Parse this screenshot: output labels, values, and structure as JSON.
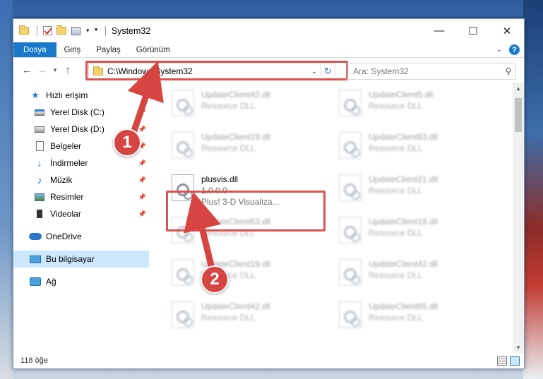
{
  "window": {
    "title": "System32",
    "controls": {
      "minimize": "—",
      "maximize": "☐",
      "close": "✕"
    }
  },
  "ribbon": {
    "tabs": [
      "Dosya",
      "Giriş",
      "Paylaş",
      "Görünüm"
    ],
    "help": "?"
  },
  "navigation": {
    "address": "C:\\Windows\\System32",
    "search_placeholder": "Ara: System32"
  },
  "sidebar": {
    "items": [
      {
        "label": "Hızlı erişim",
        "icon": "star-icon",
        "pinned": false
      },
      {
        "label": "Yerel Disk (C:)",
        "icon": "system-disk-icon",
        "pinned": true
      },
      {
        "label": "Yerel Disk (D:)",
        "icon": "disk-icon",
        "pinned": true
      },
      {
        "label": "Belgeler",
        "icon": "document-icon",
        "pinned": true
      },
      {
        "label": "İndirmeler",
        "icon": "download-icon",
        "pinned": true
      },
      {
        "label": "Müzik",
        "icon": "music-icon",
        "pinned": true
      },
      {
        "label": "Resimler",
        "icon": "pictures-icon",
        "pinned": true
      },
      {
        "label": "Videolar",
        "icon": "video-icon",
        "pinned": true
      },
      {
        "label": "OneDrive",
        "icon": "onedrive-icon",
        "pinned": false
      },
      {
        "label": "Bu bilgisayar",
        "icon": "computer-icon",
        "pinned": false,
        "selected": true
      },
      {
        "label": "Ağ",
        "icon": "network-icon",
        "pinned": false
      }
    ]
  },
  "files": [
    {
      "name": "UpdateClient42.dll",
      "desc": "Resource DLL",
      "blurred": true
    },
    {
      "name": "UpdateClient5.dll",
      "desc": "Resource DLL",
      "blurred": true
    },
    {
      "name": "UpdateClient19.dll",
      "desc": "Resource DLL",
      "blurred": true
    },
    {
      "name": "UpdateClient63.dll",
      "desc": "Resource DLL",
      "blurred": true
    },
    {
      "name": "plusvis.dll",
      "version": "1.0.0.0",
      "desc": "Plus! 3-D Visualiza...",
      "blurred": false
    },
    {
      "name": "UpdateClient21.dll",
      "desc": "Resource DLL",
      "blurred": true
    },
    {
      "name": "UpdateClient63.dll",
      "desc": "Resource DLL",
      "blurred": true
    },
    {
      "name": "UpdateClient19.dll",
      "desc": "Resource DLL",
      "blurred": true
    },
    {
      "name": "UpdateClient19.dll",
      "desc": "Resource DLL",
      "blurred": true
    },
    {
      "name": "UpdateClient42.dll",
      "desc": "Resource DLL",
      "blurred": true
    },
    {
      "name": "UpdateClient42.dll",
      "desc": "Resource DLL",
      "blurred": true
    },
    {
      "name": "UpdateClient65.dll",
      "desc": "Resource DLL",
      "blurred": true
    }
  ],
  "status": {
    "item_count": "118 öğe"
  },
  "annotations": {
    "step1": "1",
    "step2": "2",
    "color": "#d64541"
  }
}
